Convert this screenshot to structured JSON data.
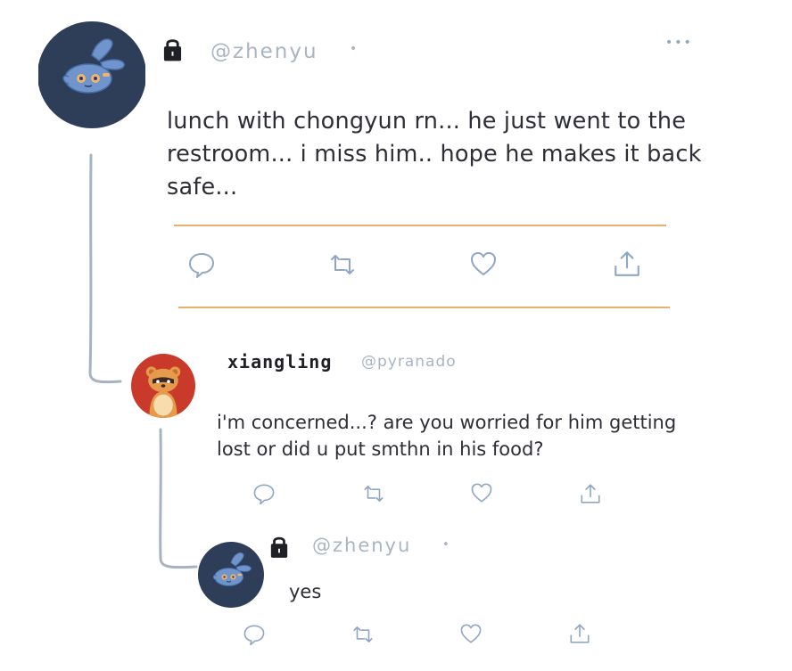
{
  "colors": {
    "handle": "#a9b4c4",
    "icon": "#8fa7c4",
    "thread_line": "#a7b3c3",
    "divider": "#e8b070",
    "avatar_navy": "#2e3d58",
    "avatar_red": "#c93a2a"
  },
  "main_post": {
    "avatar_icon": "blue-bunny-avatar",
    "handle": "@zhenyu",
    "separator": "•",
    "more": "•••",
    "text": "lunch with chongyun rn... he just went to the\nrestroom... i miss him.. hope he makes it back\nsafe...",
    "actions": [
      "reply-icon",
      "retweet-icon",
      "heart-icon",
      "share-icon"
    ]
  },
  "reply_1": {
    "avatar_icon": "tanuki-avatar",
    "display_name": "xiangling",
    "handle": "@pyranado",
    "text": "i'm concerned...? are you worried for him getting\nlost or did u put smthn in his food?",
    "actions": [
      "reply-icon",
      "retweet-icon",
      "heart-icon",
      "share-icon"
    ]
  },
  "reply_2": {
    "avatar_icon": "blue-bunny-avatar",
    "handle": "@zhenyu",
    "separator": "•",
    "text": "yes",
    "actions": [
      "reply-icon",
      "retweet-icon",
      "heart-icon",
      "share-icon"
    ]
  }
}
